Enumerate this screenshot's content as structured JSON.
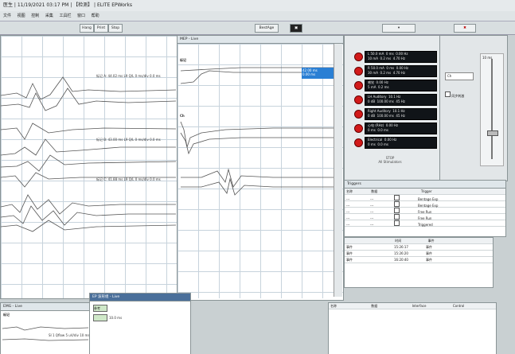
{
  "titlebar": {
    "text": "医生 | 11/19/2021 03:17 PM | 【检测】 | ELITE EPWorks"
  },
  "menu": [
    "文件",
    "视图",
    "控制",
    "采集",
    "工具栏",
    "窗口",
    "帮助"
  ],
  "toolbar": {
    "btn1": "Hang",
    "btn2": "Print",
    "btn3": "Stop",
    "btn4": "BestAge"
  },
  "left_pane": {
    "row_labels": [
      "标记 A: 44.02 ms  L9 Q/L 0 ms/div 0.0 ms",
      "标记 B: 43.00 ms  L9 Q/L 0 ms/div 0.0 ms",
      "标记 C: 41.88 ms  L9 Q/L 0 ms/div 0.0 ms"
    ]
  },
  "center_pane": {
    "title": "MEP - Live",
    "label_a": "标记",
    "label_b": "Ch",
    "highlight": "42.00 ms\n0.00 ms"
  },
  "stim_list": [
    "L 50.0 mA  0 ms  0.00 Hz\n10 mA  0.2 ms  4.70 Hz",
    "R 50.0 mA  0 ms  0.00 Hz\n30 mA  0.2 ms  4.70 Hz",
    "感觉  0.00 Hz\n5 mA  0.2 ms",
    "LH Auditory  10.1 Hz\n0 dB  100.00 ms  45 Hz",
    "Right Auditory  10.1 Hz\n0 dB  100.00 ms  45 Hz",
    "心电 (RHz)  0.00 Hz\n0 ms  0.0 ms",
    "Electrical  0.00 Hz\n0 ms  0.0 ms"
  ],
  "stop_label": "STOP\nAll Stimulators",
  "right_panel": {
    "select": "Ch",
    "checkbox": "同步刺激",
    "top": "10 ms"
  },
  "triggers_table": {
    "title": "Triggers",
    "headers": [
      "名称",
      "数据",
      "",
      "Trigger"
    ],
    "rows": [
      [
        "---",
        "---",
        "",
        "Bentage Exp"
      ],
      [
        "---",
        "---",
        "",
        "Bentage Exp"
      ],
      [
        "---",
        "---",
        "",
        "Free Run"
      ],
      [
        "---",
        "---",
        "",
        "Free Run"
      ],
      [
        "---",
        "---",
        "",
        "Triggered"
      ]
    ]
  },
  "events_table": {
    "headers": [
      "",
      "时间",
      "事件"
    ],
    "rows": [
      [
        "事件",
        "15:26:17",
        "事件"
      ],
      [
        "事件",
        "15:26:20",
        "事件"
      ],
      [
        "事件",
        "16:20:40",
        "事件"
      ]
    ]
  },
  "bottom_left": {
    "title": "EMG - Live",
    "label": "标记",
    "line": "SI 1 Qflow 5 uV/div 10 ms"
  },
  "bottom_mini": {
    "title": "EP 波形组 - Live",
    "row1": "参考",
    "row2": "10.0 ms"
  },
  "bottom_table": {
    "headers": [
      "名称",
      "数据",
      "Interface",
      "Control"
    ]
  }
}
